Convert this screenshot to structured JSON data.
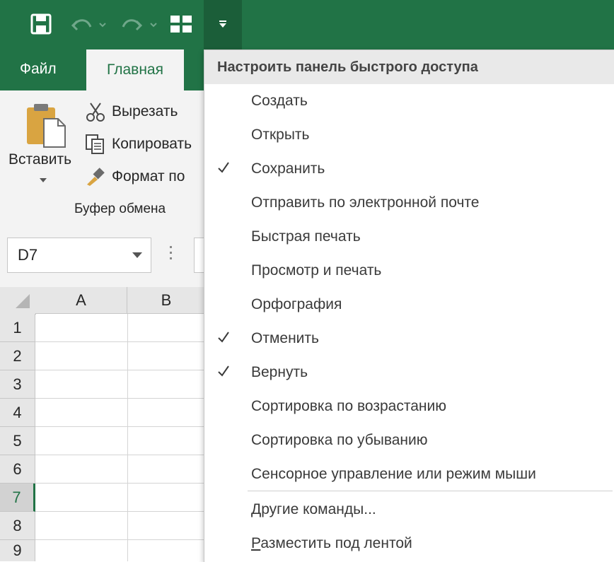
{
  "quick_access": {
    "icons": [
      "save-icon",
      "undo-icon",
      "redo-icon",
      "form-icon",
      "customize-qat-icon"
    ],
    "open_button_icon": "chevron-down-icon"
  },
  "ribbon": {
    "tabs": [
      {
        "label": "Файл"
      },
      {
        "label": "Главная"
      }
    ],
    "clipboard": {
      "paste_label": "Вставить",
      "cut_label": "Вырезать",
      "copy_label": "Копировать",
      "format_label": "Формат по",
      "group_label": "Буфер обмена"
    }
  },
  "namebox": {
    "value": "D7"
  },
  "grid": {
    "columns": [
      "A",
      "B"
    ],
    "rows": [
      "1",
      "2",
      "3",
      "4",
      "5",
      "6",
      "7",
      "8",
      "9"
    ],
    "active_row": "7"
  },
  "menu": {
    "title": "Настроить панель быстрого доступа",
    "items": [
      {
        "label": "Создать",
        "checked": false
      },
      {
        "label": "Открыть",
        "checked": false
      },
      {
        "label": "Сохранить",
        "checked": true
      },
      {
        "label": "Отправить по электронной почте",
        "checked": false
      },
      {
        "label": "Быстрая печать",
        "checked": false
      },
      {
        "label": "Просмотр и печать",
        "checked": false
      },
      {
        "label": "Орфография",
        "checked": false
      },
      {
        "label": "Отменить",
        "checked": true
      },
      {
        "label": "Вернуть",
        "checked": true
      },
      {
        "label": "Сортировка по возрастанию",
        "checked": false
      },
      {
        "label": "Сортировка по убыванию",
        "checked": false
      },
      {
        "label": "Сенсорное управление или режим мыши",
        "checked": false
      }
    ],
    "more_commands": {
      "prefix": "Д",
      "rest": "ругие команды..."
    },
    "below_ribbon": {
      "prefix": "Р",
      "rest": "азместить под лентой"
    }
  },
  "colors": {
    "accent": "#217346",
    "accent_dark": "#1b5e39",
    "ribbon_bg": "#f3f3f3"
  }
}
